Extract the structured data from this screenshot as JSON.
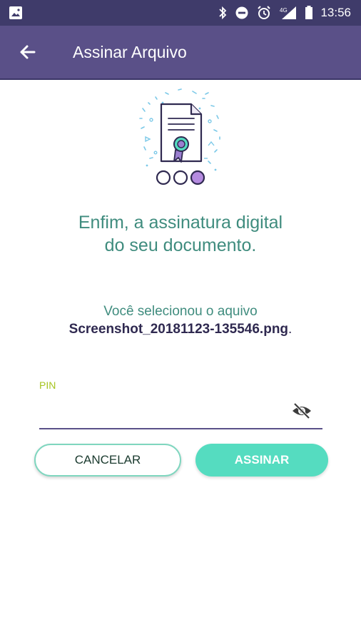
{
  "status_bar": {
    "time": "13:56",
    "network": "4G",
    "icons": [
      "image-icon",
      "bluetooth-icon",
      "do-not-disturb-icon",
      "alarm-icon",
      "signal-icon",
      "battery-icon"
    ]
  },
  "app_bar": {
    "title": "Assinar Arquivo",
    "back_icon": "arrow-back-icon",
    "background": "#5a5088"
  },
  "illustration": {
    "icon": "certificate-document-icon",
    "steps_total": 3,
    "step_active": 3
  },
  "heading": {
    "line1": "Enfim, a assinatura digital",
    "line2": "do seu documento."
  },
  "selection": {
    "prefix": "Você selecionou o aquivo",
    "filename": "Screenshot_20181123-135546.png",
    "suffix": "."
  },
  "pin_field": {
    "label": "PIN",
    "value": "",
    "visibility_icon": "eye-off-icon"
  },
  "buttons": {
    "cancel": "CANCELAR",
    "sign": "ASSINAR"
  },
  "colors": {
    "primary": "#5a5088",
    "accent": "#55dcc0",
    "text_green": "#3f8c7e",
    "pin_label": "#a6c41f"
  }
}
